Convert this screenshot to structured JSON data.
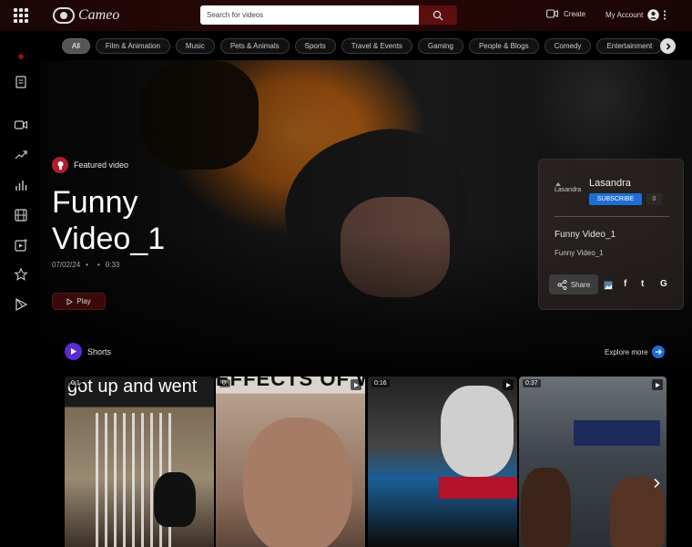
{
  "header": {
    "brand": "Cameo",
    "search_placeholder": "Search for videos",
    "create_label": "Create",
    "account_label": "My Account"
  },
  "categories": [
    "All",
    "Film & Animation",
    "Music",
    "Pets & Animals",
    "Sports",
    "Travel & Events",
    "Gaming",
    "People & Blogs",
    "Comedy",
    "Entertainment"
  ],
  "featured": {
    "badge_label": "Featured video",
    "title": "Funny Video_1",
    "date": "07/02/24",
    "sep1": "•",
    "sep2": "•",
    "duration": "0:33",
    "play_label": "Play"
  },
  "channel_card": {
    "avatar_alt": "Lasandra",
    "channel_name": "Lasandra",
    "subscribe_label": "SUBSCRIBE",
    "subscriber_count": "0",
    "video_title": "Funny Video_1",
    "video_description": "Funny Video_1",
    "share_label": "Share",
    "social": [
      "f",
      "t",
      "G"
    ]
  },
  "shorts": {
    "heading": "Shorts",
    "explore_label": "Explore more",
    "items": [
      {
        "duration": "0:1",
        "caption": "got up and went"
      },
      {
        "duration": "0:",
        "caption": "EFFECTS OF WO"
      },
      {
        "duration": "0:16",
        "caption": ""
      },
      {
        "duration": "0:37",
        "caption": ""
      }
    ]
  },
  "colors": {
    "accent_red": "#b01d2e",
    "subscribe_blue": "#1d6fd6",
    "shorts_purple": "#5b2bd6"
  }
}
